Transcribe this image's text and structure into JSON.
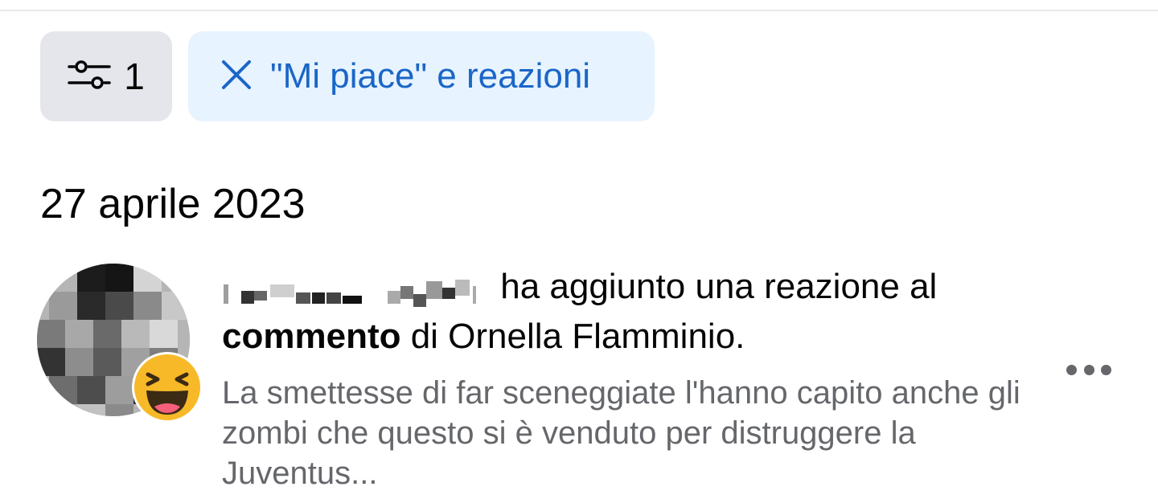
{
  "filters": {
    "count_icon": "sliders-icon",
    "count_value": "1",
    "active_chip": {
      "close_icon": "close-icon",
      "label": "\"Mi piace\" e reazioni"
    }
  },
  "section": {
    "date": "27 aprile 2023"
  },
  "notification": {
    "actor_name_blurred": "[redacted name]",
    "action_text": " ha aggiunto una reazione al ",
    "target_bold": "commento",
    "target_rest": " di Ornella Flamminio.",
    "preview_text": "La smettesse di far sceneggiate l'hanno capito anche gli zombi che questo si è venduto per distruggere la Juventus...",
    "reaction": "laughing-emoji-icon",
    "more_icon": "more-options-icon"
  },
  "colors": {
    "chip_bg": "#e7f3ff",
    "chip_text": "#1a66c8",
    "count_btn_bg": "#e4e6eb",
    "secondary_text": "#65676b"
  }
}
